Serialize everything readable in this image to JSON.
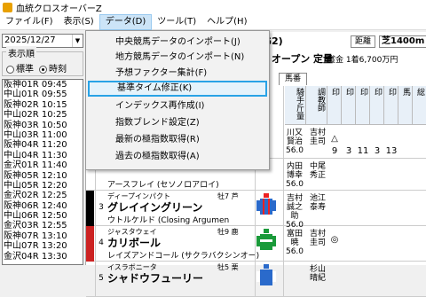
{
  "window": {
    "title": "血統クロスオーバーZ"
  },
  "menubar": [
    "ファイル(F)",
    "表示(S)",
    "データ(D)",
    "ツール(T)",
    "ヘルプ(H)"
  ],
  "left": {
    "date": "2025/12/27",
    "order_label": "表示順",
    "radio_standard": "標準",
    "radio_time": "時刻",
    "races": [
      "阪神01R 09:45",
      "中山01R 09:55",
      "阪神02R 10:15",
      "中山02R 10:25",
      "阪神03R 10:50",
      "中山03R 11:00",
      "阪神04R 11:20",
      "中山04R 11:30",
      "金沢01R 11:40",
      "阪神05R 12:10",
      "中山05R 12:20",
      "金沢02R 12:25",
      "阪神06R 12:40",
      "中山06R 12:50",
      "金沢03R 12:55",
      "阪神07R 13:10",
      "中山07R 13:20",
      "金沢04R 13:30"
    ]
  },
  "main": {
    "race_class": "G2)",
    "race_sub": ") オープン 定量",
    "dist_label": "距離",
    "dist_value": "芝1400m",
    "prize": "賞金 1着6,700万円",
    "tab": "馬番",
    "headers": [
      "騎手斤量",
      "調教師",
      "印",
      "印",
      "印",
      "印",
      "印",
      "馬",
      "総"
    ],
    "rows": [
      {
        "sire": "",
        "name": "",
        "dam": "",
        "sexage": "",
        "jockey": "川又賢治 56.0",
        "trainer": "吉村圭司",
        "marks": [
          "△",
          "",
          "",
          "",
          "",
          "",
          ""
        ],
        "nums": [
          "9",
          "3",
          "11",
          "3",
          "13"
        ]
      },
      {
        "sire": "",
        "name": "",
        "dam": "アースフレイ (セソノロアロイ)",
        "sexage": "",
        "jockey": "内田博幸 56.0",
        "trainer": "中尾秀正",
        "marks": [
          "",
          "",
          "",
          "",
          "",
          "",
          ""
        ],
        "nums": [
          "",
          "",
          "",
          "",
          ""
        ]
      },
      {
        "umaban": "3",
        "sire": "ディープインパクト",
        "name": "グレイイングリーン",
        "dam": "ウトルケルド (Closing Argumen",
        "sexage": "牡7 芦",
        "jockey": "吉村誠之助 56.0",
        "trainer": "池江泰寿",
        "marks": [
          "",
          "",
          "",
          "",
          "",
          "",
          ""
        ],
        "nums": [
          "",
          "",
          "",
          "",
          ""
        ]
      },
      {
        "umaban": "4",
        "sire": "ジャスタウェイ",
        "name": "カリボール",
        "dam": "レイズアンドコール (サクラバクシンオー)",
        "sexage": "牡9 鹿",
        "jockey": "富田暁 56.0",
        "trainer": "吉村圭司",
        "marks": [
          "◎",
          "",
          "",
          "",
          "",
          "",
          ""
        ],
        "nums": [
          "",
          "",
          "",
          "",
          ""
        ]
      },
      {
        "umaban": "5",
        "sire": "イスラボニータ",
        "name": "シャドウフューリー",
        "dam": "",
        "sexage": "牡5 栗",
        "jockey": "",
        "trainer": "杉山晴紀",
        "marks": [
          "",
          "",
          "",
          "",
          "",
          "",
          ""
        ],
        "nums": [
          "",
          "",
          "",
          "",
          ""
        ]
      }
    ]
  },
  "dropdown": {
    "items": [
      "中央競馬データのインポート(J)",
      "地方競馬データのインポート(N)",
      "予想ファクター集計(F)",
      "基準タイム修正(K)",
      "インデックス再作成(I)",
      "指数ブレンド設定(Z)",
      "最新の極指数取得(R)",
      "過去の極指数取得(A)"
    ],
    "highlighted_index": 3
  },
  "colors": {
    "highlight": "#29a3e6",
    "waku2": "#000000",
    "waku1": "#ffffff"
  }
}
